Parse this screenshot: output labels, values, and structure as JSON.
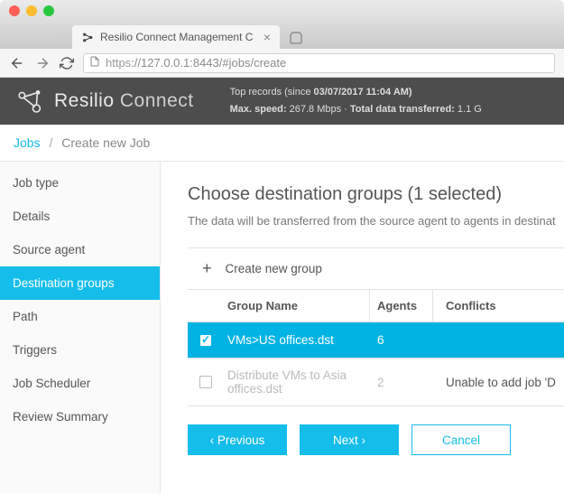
{
  "window": {
    "tab_title": "Resilio Connect Management C",
    "url_proto": "https",
    "url_rest": "://127.0.0.1:8443/#jobs/create"
  },
  "header": {
    "brand1": "Resilio",
    "brand2": "Connect",
    "top_records_label": "Top records (since",
    "top_records_time": "03/07/2017 11:04 AM)",
    "max_speed_label": "Max. speed:",
    "max_speed_val": "267.8 Mbps",
    "total_label": "Total data transferred:",
    "total_val": "1.1 G"
  },
  "breadcrumb": {
    "root": "Jobs",
    "current": "Create new Job"
  },
  "sidebar": {
    "items": [
      {
        "label": "Job type"
      },
      {
        "label": "Details"
      },
      {
        "label": "Source agent"
      },
      {
        "label": "Destination groups",
        "active": true
      },
      {
        "label": "Path"
      },
      {
        "label": "Triggers"
      },
      {
        "label": "Job Scheduler"
      },
      {
        "label": "Review Summary"
      }
    ]
  },
  "content": {
    "title": "Choose destination groups (1 selected)",
    "desc": "The data will be transferred from the source agent to agents in destinat",
    "create_new": "Create new group",
    "columns": {
      "name": "Group Name",
      "agents": "Agents",
      "conflicts": "Conflicts"
    },
    "rows": [
      {
        "name": "VMs>US offices.dst",
        "agents": "6",
        "conflicts": "",
        "selected": true
      },
      {
        "name": "Distribute VMs to Asia offices.dst",
        "agents": "2",
        "conflicts": "Unable to add job 'D",
        "disabled": true
      }
    ]
  },
  "buttons": {
    "prev": "‹ Previous",
    "next": "Next ›",
    "cancel": "Cancel"
  }
}
